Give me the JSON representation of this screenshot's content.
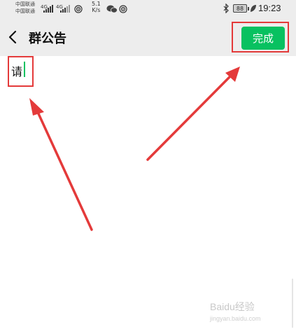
{
  "status_bar": {
    "carrier_1": "中国联通",
    "carrier_2": "中国联通",
    "network_1": "4G",
    "network_2": "4G",
    "speed_value": "5.1",
    "speed_unit": "K/s",
    "battery": "88",
    "time": "19:23"
  },
  "nav": {
    "title": "群公告",
    "done_label": "完成"
  },
  "editor": {
    "text": "请"
  },
  "watermark": {
    "brand": "Baidu经验",
    "url": "jingyan.baidu.com"
  },
  "colors": {
    "accent_green": "#08c160",
    "annotation_red": "#e43a3a",
    "header_bg": "#ededed"
  }
}
